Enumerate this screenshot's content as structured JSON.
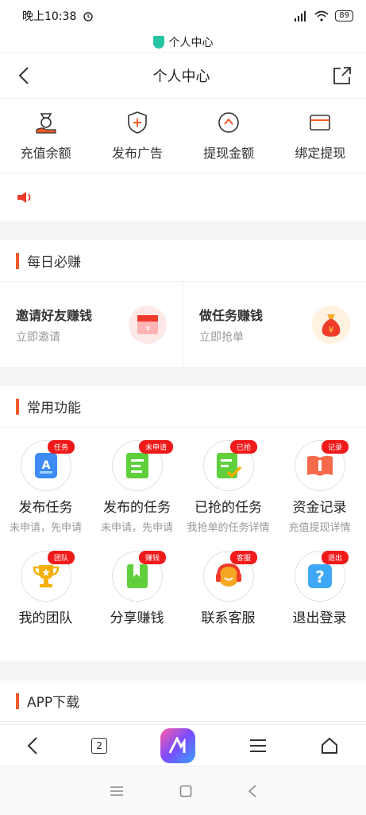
{
  "status": {
    "time": "晚上10:38",
    "battery": "89"
  },
  "url": {
    "title": "个人中心"
  },
  "header": {
    "title": "个人中心"
  },
  "quick": [
    {
      "label": "充值余额",
      "icon": "wallet-hand-icon"
    },
    {
      "label": "发布广告",
      "icon": "shield-plus-icon"
    },
    {
      "label": "提现金额",
      "icon": "withdraw-icon"
    },
    {
      "label": "绑定提现",
      "icon": "card-icon"
    }
  ],
  "daily": {
    "title": "每日必赚",
    "cards": [
      {
        "title": "邀请好友赚钱",
        "sub": "立即邀请",
        "icon": "gift-envelope-icon"
      },
      {
        "title": "做任务赚钱",
        "sub": "立即抢单",
        "icon": "money-bag-icon"
      }
    ]
  },
  "common": {
    "title": "常用功能",
    "items": [
      {
        "name": "发布任务",
        "badge": "任务",
        "desc": "未申请，先申请"
      },
      {
        "name": "发布的任务",
        "badge": "未申请",
        "desc": "未申请，先申请"
      },
      {
        "name": "已抢的任务",
        "badge": "已抢",
        "desc": "我抢单的任务详情"
      },
      {
        "name": "资金记录",
        "badge": "记录",
        "desc": "充值提现详情"
      },
      {
        "name": "我的团队",
        "badge": "团队",
        "desc": ""
      },
      {
        "name": "分享赚钱",
        "badge": "赚钱",
        "desc": ""
      },
      {
        "name": "联系客服",
        "badge": "客服",
        "desc": ""
      },
      {
        "name": "退出登录",
        "badge": "退出",
        "desc": ""
      }
    ]
  },
  "download": {
    "title": "APP下载"
  },
  "nav": {
    "tabs_count": "2"
  },
  "colors": {
    "accent": "#f25a28",
    "badge": "#f01a1a"
  }
}
